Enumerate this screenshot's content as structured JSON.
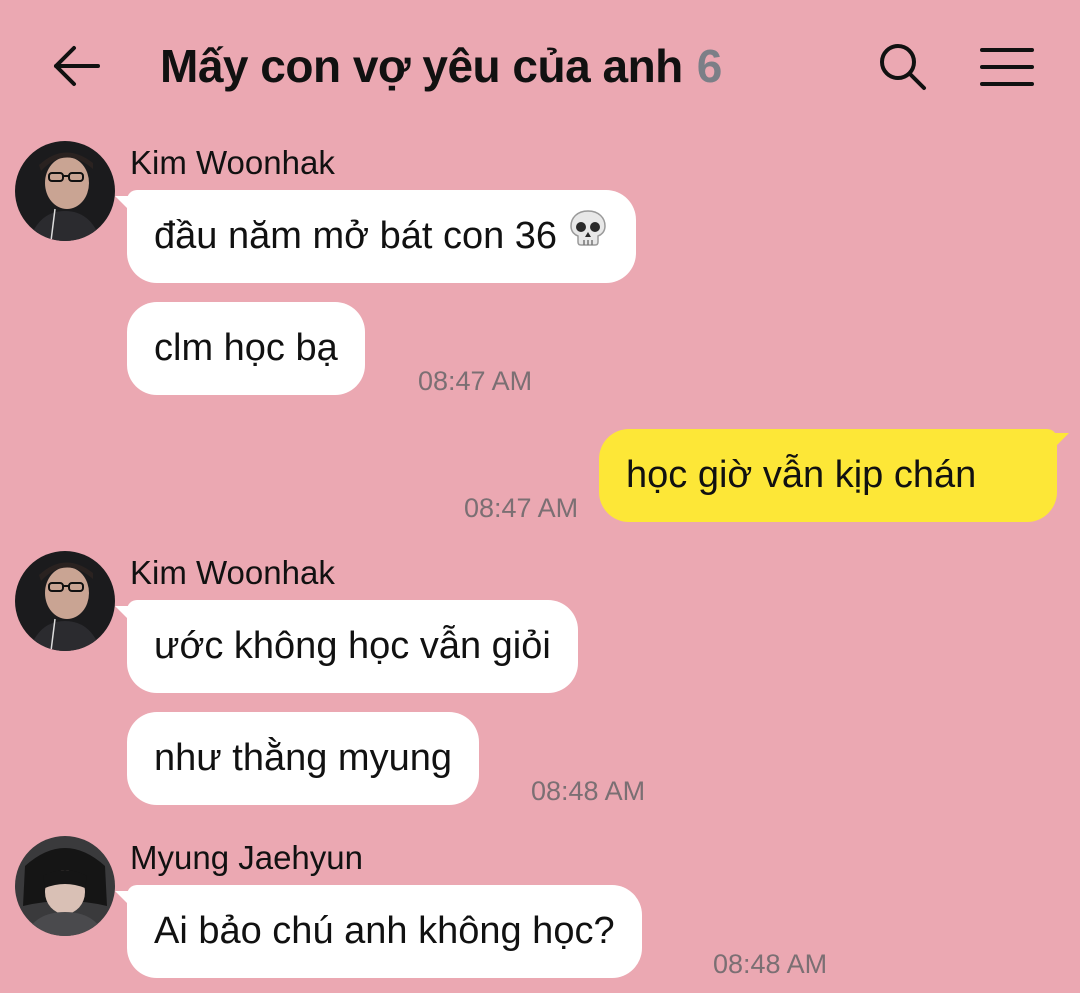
{
  "header": {
    "title": "Mấy con vợ yêu của anh",
    "member_count": "6"
  },
  "colors": {
    "background": "#eba8b2",
    "incoming_bubble": "#ffffff",
    "outgoing_bubble": "#fde737",
    "timestamp": "#7b6f73",
    "member_count": "#7b7f87"
  },
  "messages": [
    {
      "sender": "Kim Woonhak",
      "text": "đầu năm mở bát con 36",
      "emoji": "skull-emoji"
    },
    {
      "text": "clm học bạ",
      "time": "08:47 AM"
    },
    {
      "text": "học giờ vẫn kịp chán",
      "time": "08:47 AM",
      "outgoing": true
    },
    {
      "sender": "Kim Woonhak",
      "text": "ước không học vẫn giỏi"
    },
    {
      "text": "như thằng myung",
      "time": "08:48 AM"
    },
    {
      "sender": "Myung Jaehyun",
      "text": "Ai bảo chú anh không học?",
      "time": "08:48 AM"
    }
  ]
}
